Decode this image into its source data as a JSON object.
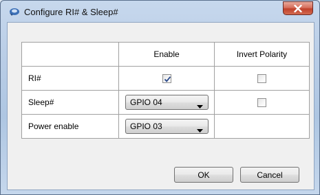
{
  "window": {
    "title": "Configure RI# & Sleep#",
    "close_label": "X"
  },
  "table": {
    "headers": [
      "",
      "Enable",
      "Invert Polarity"
    ],
    "rows": [
      {
        "label": "RI#",
        "enable_checked": true,
        "invert_checked": false
      },
      {
        "label": "Sleep#",
        "enable_value": "GPIO 04",
        "invert_checked": false
      },
      {
        "label": "Power enable",
        "enable_value": "GPIO 03"
      }
    ]
  },
  "buttons": {
    "ok": "OK",
    "cancel": "Cancel"
  },
  "icons": {
    "app": "settings-app-icon",
    "close": "close-icon",
    "checkmark": "checkmark-icon",
    "dropdown": "chevron-down-icon"
  },
  "colors": {
    "close_button": "#c1412b",
    "checkmark": "#2b4a8a"
  }
}
